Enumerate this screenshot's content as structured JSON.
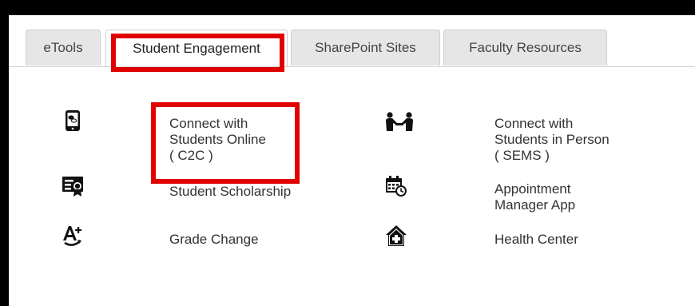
{
  "tabs": [
    {
      "label": "eTools",
      "active": false
    },
    {
      "label": "Student Engagement",
      "active": true
    },
    {
      "label": "SharePoint Sites",
      "active": false
    },
    {
      "label": "Faculty Resources",
      "active": false
    }
  ],
  "links": {
    "c2c": {
      "line1": "Connect with",
      "line2": "Students Online",
      "line3": "( C2C )",
      "icon": "tablet-chat-icon"
    },
    "sems": {
      "line1": "Connect with",
      "line2": "Students in Person",
      "line3": "( SEMS )",
      "icon": "people-meeting-icon"
    },
    "scholarship": {
      "label": "Student Scholarship",
      "icon": "certificate-icon"
    },
    "appointment": {
      "line1": "Appointment",
      "line2": "Manager App",
      "icon": "calendar-clock-icon"
    },
    "grade": {
      "label": "Grade Change",
      "icon": "grade-plus-icon"
    },
    "health": {
      "label": "Health Center",
      "icon": "home-health-icon"
    }
  },
  "colors": {
    "highlight": "#e00000",
    "tab_bg": "#e6e6e6",
    "icon": "#111111"
  }
}
